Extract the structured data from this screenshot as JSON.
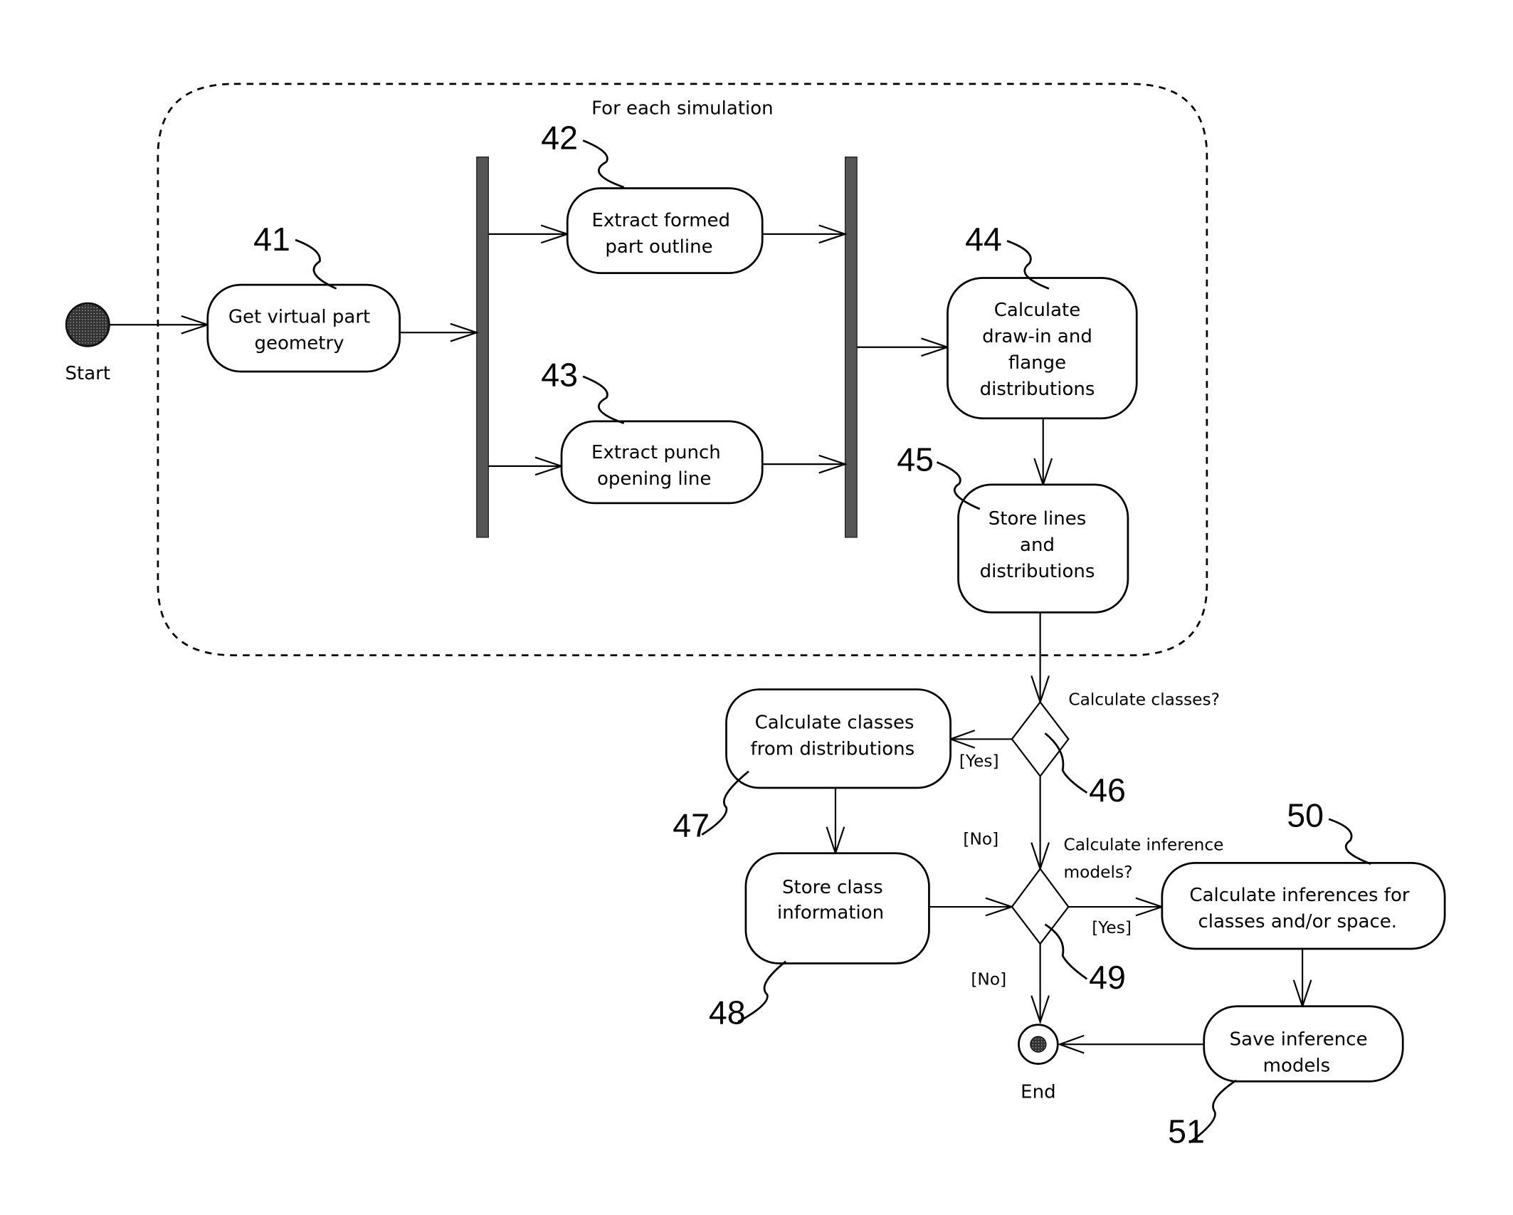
{
  "diagram": {
    "type": "UML activity diagram",
    "loop_label": "For each simulation",
    "start_label": "Start",
    "end_label": "End",
    "nodes": [
      {
        "id": "41",
        "lines": [
          "Get virtual part",
          "geometry"
        ]
      },
      {
        "id": "42",
        "lines": [
          "Extract formed",
          "part outline"
        ]
      },
      {
        "id": "43",
        "lines": [
          "Extract punch",
          "opening line"
        ]
      },
      {
        "id": "44",
        "lines": [
          "Calculate",
          "draw-in and",
          "flange",
          "distributions"
        ]
      },
      {
        "id": "45",
        "lines": [
          "Store lines",
          "and",
          "distributions"
        ]
      },
      {
        "id": "47",
        "lines": [
          "Calculate classes",
          "from distributions"
        ]
      },
      {
        "id": "48",
        "lines": [
          "Store class",
          "information"
        ]
      },
      {
        "id": "50",
        "lines": [
          "Calculate inferences for",
          "classes and/or space."
        ]
      },
      {
        "id": "51",
        "lines": [
          "Save inference",
          "models"
        ]
      }
    ],
    "decisions": [
      {
        "id": "46",
        "question": [
          "Calculate classes?"
        ],
        "yes": "[Yes]",
        "no": "[No]"
      },
      {
        "id": "49",
        "question": [
          "Calculate inference",
          "models?"
        ],
        "yes": "[Yes]",
        "no": "[No]"
      }
    ],
    "refs": {
      "r41": "41",
      "r42": "42",
      "r43": "43",
      "r44": "44",
      "r45": "45",
      "r46": "46",
      "r47": "47",
      "r48": "48",
      "r49": "49",
      "r50": "50",
      "r51": "51"
    }
  }
}
